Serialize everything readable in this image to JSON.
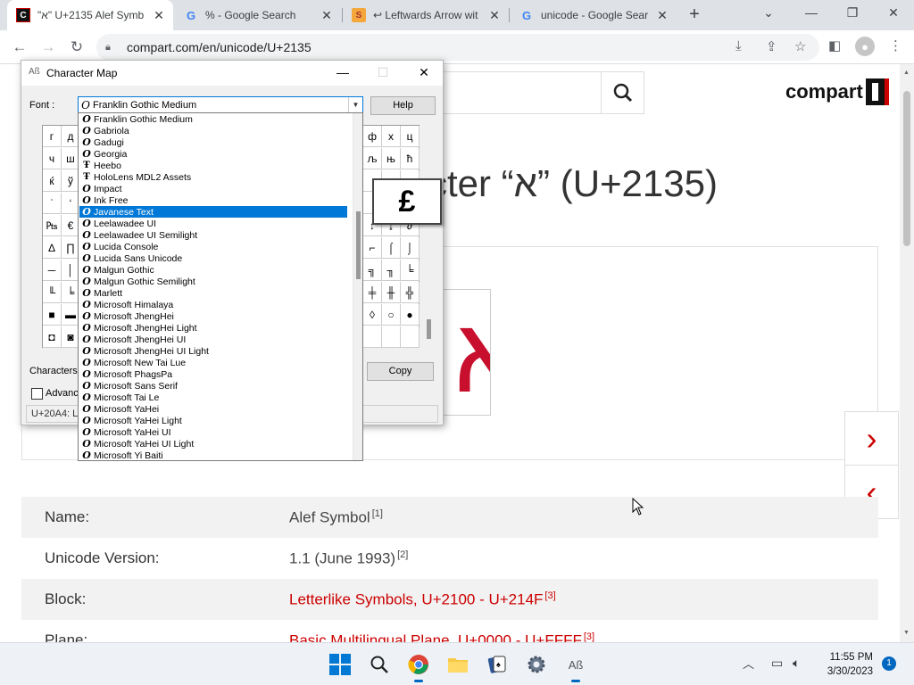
{
  "browser": {
    "tabs": [
      {
        "title": "\"א\" U+2135 Alef Symb",
        "favicon": "compart-icon",
        "active": true
      },
      {
        "title": "% - Google Search",
        "favicon": "google-icon",
        "active": false
      },
      {
        "title": "↩ Leftwards Arrow wit",
        "favicon": "symbl-icon",
        "active": false
      },
      {
        "title": "unicode - Google Sear",
        "favicon": "google-icon",
        "active": false
      }
    ],
    "url": "compart.com/en/unicode/U+2135"
  },
  "page": {
    "logo_text": "compart",
    "heading": "cter “א” (U+2135)",
    "glyph": "א",
    "next_arrow": "›",
    "prev_arrow": "‹",
    "info_rows": [
      {
        "label": "Name:",
        "value": "Alef Symbol",
        "ref": "[1]",
        "link": false
      },
      {
        "label": "Unicode Version:",
        "value": "1.1 (June 1993)",
        "ref": "[2]",
        "link": false
      },
      {
        "label": "Block:",
        "value": "Letterlike Symbols, U+2100 - U+214F",
        "ref": "[3]",
        "link": true
      },
      {
        "label": "Plane:",
        "value": "Basic Multilingual Plane, U+0000 - U+FFFF",
        "ref": "[3]",
        "link": true
      }
    ]
  },
  "charmap": {
    "title": "Character Map",
    "font_label": "Font :",
    "selected_font": "Franklin Gothic Medium",
    "help_label": "Help",
    "copy_label": "Copy",
    "characters_label": "Characters",
    "advanced_label": "Advanc",
    "status_text": "U+20A4: L",
    "enlarged_char": "£",
    "grid_left": [
      [
        "г",
        "д"
      ],
      [
        "ч",
        "ш"
      ],
      [
        "ќ",
        "ў"
      ],
      [
        "ˈ",
        "‘"
      ],
      [
        "₧",
        "€"
      ],
      [
        "∆",
        "∏"
      ],
      [
        "─",
        "│"
      ],
      [
        "╙",
        "╘"
      ],
      [
        "■",
        "▬"
      ],
      [
        "◘",
        "◙"
      ]
    ],
    "grid_right": [
      [
        "ф",
        "х",
        "ц"
      ],
      [
        "љ",
        "њ",
        "ћ"
      ],
      [
        "",
        "",
        ""
      ],
      [
        "",
        "",
        ""
      ],
      [
        "↕",
        "↨",
        "∂"
      ],
      [
        "⌐",
        "⌠",
        "⌡"
      ],
      [
        "╗",
        "╖",
        "╘"
      ],
      [
        "╪",
        "╫",
        "╬"
      ],
      [
        "◊",
        "○",
        "●"
      ],
      [
        "",
        "",
        ""
      ]
    ],
    "font_list": [
      {
        "name": "Franklin Gothic Medium",
        "type": "otf"
      },
      {
        "name": "Gabriola",
        "type": "otf"
      },
      {
        "name": "Gadugi",
        "type": "otf"
      },
      {
        "name": "Georgia",
        "type": "otf"
      },
      {
        "name": "Heebo",
        "type": "ttf"
      },
      {
        "name": "HoloLens MDL2 Assets",
        "type": "ttf"
      },
      {
        "name": "Impact",
        "type": "otf"
      },
      {
        "name": "Ink Free",
        "type": "otf"
      },
      {
        "name": "Javanese Text",
        "type": "otf",
        "selected": true
      },
      {
        "name": "Leelawadee UI",
        "type": "otf"
      },
      {
        "name": "Leelawadee UI Semilight",
        "type": "otf"
      },
      {
        "name": "Lucida Console",
        "type": "otf"
      },
      {
        "name": "Lucida Sans Unicode",
        "type": "otf"
      },
      {
        "name": "Malgun Gothic",
        "type": "otf"
      },
      {
        "name": "Malgun Gothic Semilight",
        "type": "otf"
      },
      {
        "name": "Marlett",
        "type": "otf"
      },
      {
        "name": "Microsoft Himalaya",
        "type": "otf"
      },
      {
        "name": "Microsoft JhengHei",
        "type": "otf"
      },
      {
        "name": "Microsoft JhengHei Light",
        "type": "otf"
      },
      {
        "name": "Microsoft JhengHei UI",
        "type": "otf"
      },
      {
        "name": "Microsoft JhengHei UI Light",
        "type": "otf"
      },
      {
        "name": "Microsoft New Tai Lue",
        "type": "otf"
      },
      {
        "name": "Microsoft PhagsPa",
        "type": "otf"
      },
      {
        "name": "Microsoft Sans Serif",
        "type": "otf"
      },
      {
        "name": "Microsoft Tai Le",
        "type": "otf"
      },
      {
        "name": "Microsoft YaHei",
        "type": "otf"
      },
      {
        "name": "Microsoft YaHei Light",
        "type": "otf"
      },
      {
        "name": "Microsoft YaHei UI",
        "type": "otf"
      },
      {
        "name": "Microsoft YaHei UI Light",
        "type": "otf"
      },
      {
        "name": "Microsoft Yi Baiti",
        "type": "otf"
      }
    ]
  },
  "taskbar": {
    "apps": [
      "windows-start-icon",
      "search-icon",
      "chrome-icon",
      "file-explorer-icon",
      "solitaire-icon",
      "settings-icon",
      "character-map-icon"
    ],
    "time": "11:55 PM",
    "date": "3/30/2023",
    "notifications": "1"
  }
}
